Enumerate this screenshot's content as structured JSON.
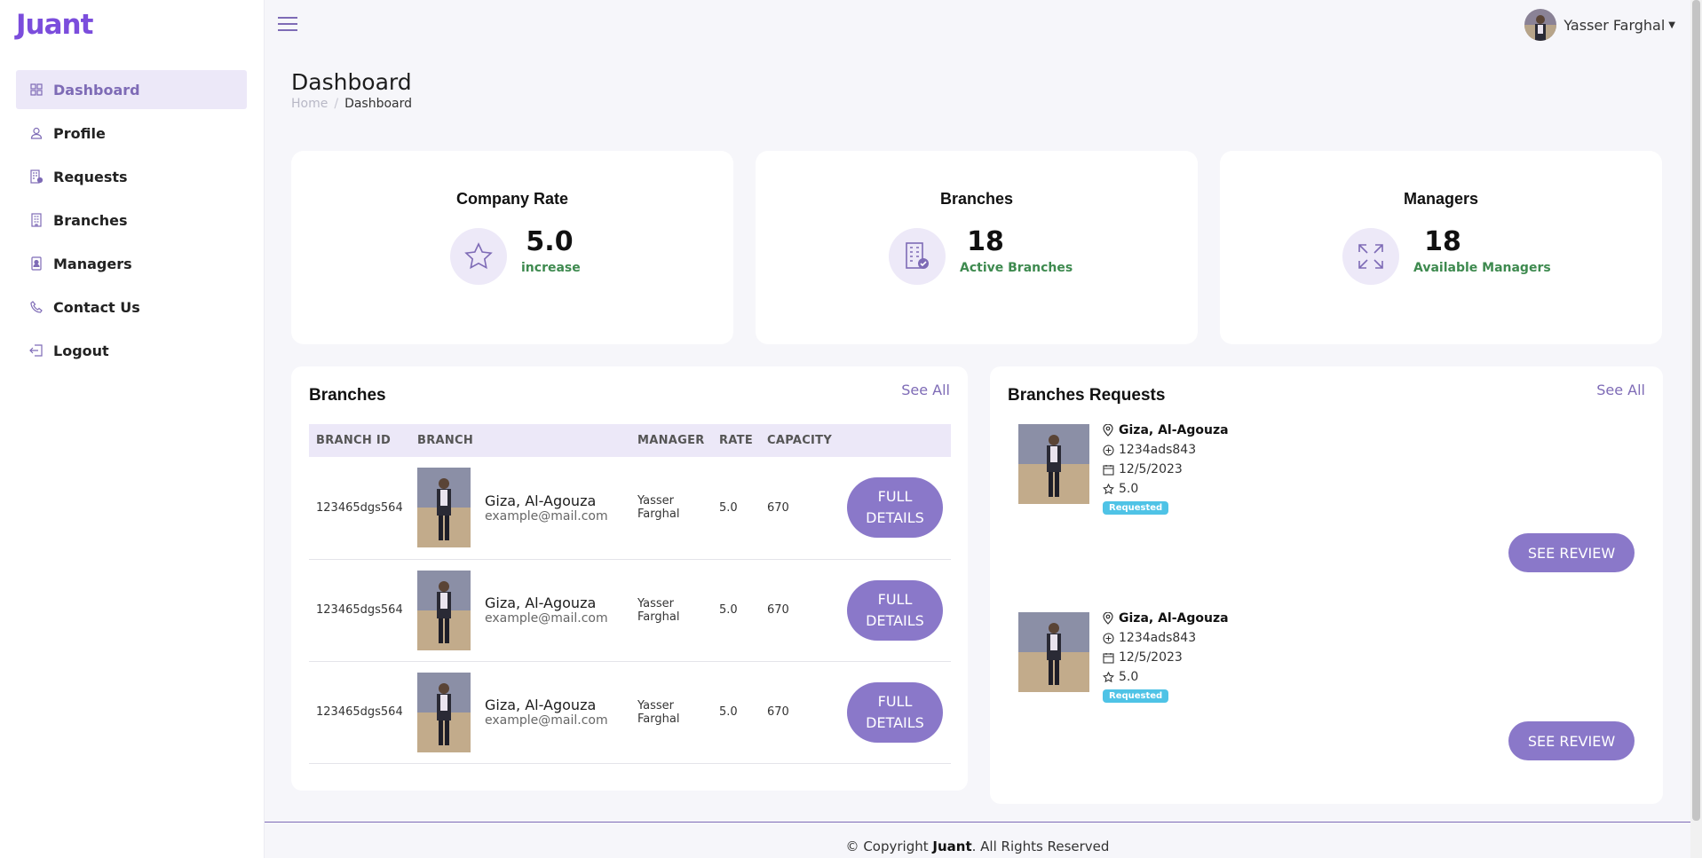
{
  "app": {
    "logo": "Juant"
  },
  "user": {
    "name": "Yasser Farghal"
  },
  "sidebar": {
    "items": [
      {
        "label": "Dashboard",
        "icon": "dashboard-icon"
      },
      {
        "label": "Profile",
        "icon": "user-icon"
      },
      {
        "label": "Requests",
        "icon": "requests-icon"
      },
      {
        "label": "Branches",
        "icon": "building-icon"
      },
      {
        "label": "Managers",
        "icon": "manager-icon"
      },
      {
        "label": "Contact Us",
        "icon": "phone-icon"
      },
      {
        "label": "Logout",
        "icon": "logout-icon"
      }
    ]
  },
  "page": {
    "title": "Dashboard",
    "breadcrumb": {
      "home": "Home",
      "separator": "/",
      "current": "Dashboard"
    }
  },
  "stats": [
    {
      "title": "Company Rate",
      "value": "5.0",
      "sub": "increase",
      "icon": "star-icon"
    },
    {
      "title": "Branches",
      "value": "18",
      "sub": "Active Branches",
      "icon": "building-check-icon"
    },
    {
      "title": "Managers",
      "value": "18",
      "sub": "Available Managers",
      "icon": "expand-icon"
    }
  ],
  "branches_panel": {
    "title": "Branches",
    "see_all": "See All",
    "columns": [
      "BRANCH ID",
      "BRANCH",
      "MANAGER",
      "RATE",
      "CAPACITY"
    ],
    "rows": [
      {
        "id": "123465dgs564",
        "name": "Giza, Al-Agouza",
        "email": "example@mail.com",
        "manager": "Yasser Farghal",
        "rate": "5.0",
        "capacity": "670",
        "button": "FULL DETAILS"
      },
      {
        "id": "123465dgs564",
        "name": "Giza, Al-Agouza",
        "email": "example@mail.com",
        "manager": "Yasser Farghal",
        "rate": "5.0",
        "capacity": "670",
        "button": "FULL DETAILS"
      },
      {
        "id": "123465dgs564",
        "name": "Giza, Al-Agouza",
        "email": "example@mail.com",
        "manager": "Yasser Farghal",
        "rate": "5.0",
        "capacity": "670",
        "button": "FULL DETAILS"
      }
    ]
  },
  "requests_panel": {
    "title": "Branches Requests",
    "see_all": "See All",
    "items": [
      {
        "location": "Giza, Al-Agouza",
        "code": "1234ads843",
        "date": "12/5/2023",
        "rate": "5.0",
        "status": "Requested",
        "button": "SEE REVIEW"
      },
      {
        "location": "Giza, Al-Agouza",
        "code": "1234ads843",
        "date": "12/5/2023",
        "rate": "5.0",
        "status": "Requested",
        "button": "SEE REVIEW"
      }
    ]
  },
  "footer": {
    "prefix": "© Copyright",
    "brand": "Juant",
    "suffix": ". All Rights Reserved"
  },
  "colors": {
    "accent": "#7e6bb6",
    "button": "#8a78c9",
    "positive": "#3e8a4f",
    "badge": "#4fc3e6"
  }
}
